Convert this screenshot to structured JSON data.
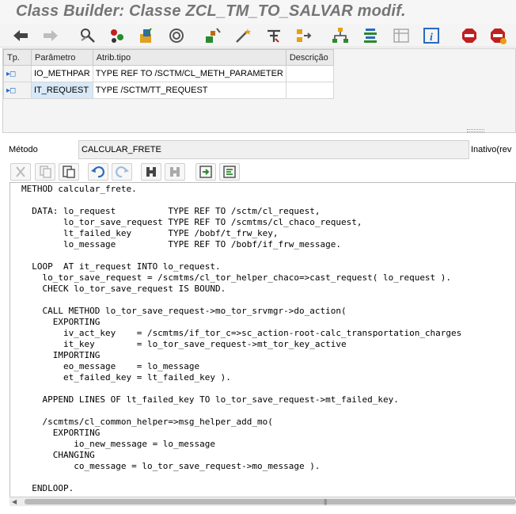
{
  "window": {
    "title": "Class Builder: Classe ZCL_TM_TO_SALVAR modif."
  },
  "toolbar": {
    "icons": [
      "back-arrow-icon",
      "forward-arrow-icon",
      "display-change-icon",
      "active-inactive-icon",
      "check-icon",
      "activate-icon",
      "test-icon",
      "where-used-icon",
      "magic-wand-icon",
      "print-icon",
      "navigation-icon",
      "hierarchy-icon",
      "list-icon",
      "display-object-list-icon",
      "info-icon",
      "stop-breakpoint-icon",
      "stop-session-icon"
    ]
  },
  "params": {
    "headers": {
      "tp": "Tp.",
      "param": "Parâmetro",
      "type": "Atrib.tipo",
      "desc": "Descrição"
    },
    "rows": [
      {
        "tp": "▸◻",
        "name": "IO_METHPAR",
        "type": "TYPE REF TO /SCTM/CL_METH_PARAMETER",
        "desc": ""
      },
      {
        "tp": "▸◻",
        "name": "IT_REQUEST",
        "type": "TYPE /SCTM/TT_REQUEST",
        "desc": ""
      }
    ]
  },
  "method": {
    "label": "Método",
    "value": "CALCULAR_FRETE",
    "status": "Inativo(rev"
  },
  "code": {
    "lines": [
      "METHOD calcular_frete.",
      "",
      "  DATA: lo_request          TYPE REF TO /sctm/cl_request,",
      "        lo_tor_save_request TYPE REF TO /scmtms/cl_chaco_request,",
      "        lt_failed_key       TYPE /bobf/t_frw_key,",
      "        lo_message          TYPE REF TO /bobf/if_frw_message.",
      "",
      "  LOOP  AT it_request INTO lo_request.",
      "    lo_tor_save_request = /scmtms/cl_tor_helper_chaco=>cast_request( lo_request ).",
      "    CHECK lo_tor_save_request IS BOUND.",
      "",
      "    CALL METHOD lo_tor_save_request->mo_tor_srvmgr->do_action(",
      "      EXPORTING",
      "        iv_act_key    = /scmtms/if_tor_c=>sc_action-root-calc_transportation_charges",
      "        it_key        = lo_tor_save_request->mt_tor_key_active",
      "      IMPORTING",
      "        eo_message    = lo_message",
      "        et_failed_key = lt_failed_key ).",
      "",
      "    APPEND LINES OF lt_failed_key TO lo_tor_save_request->mt_failed_key.",
      "",
      "    /scmtms/cl_common_helper=>msg_helper_add_mo(",
      "      EXPORTING",
      "          io_new_message = lo_message",
      "      CHANGING",
      "          co_message = lo_tor_save_request->mo_message ).",
      "",
      "  ENDLOOP."
    ]
  }
}
